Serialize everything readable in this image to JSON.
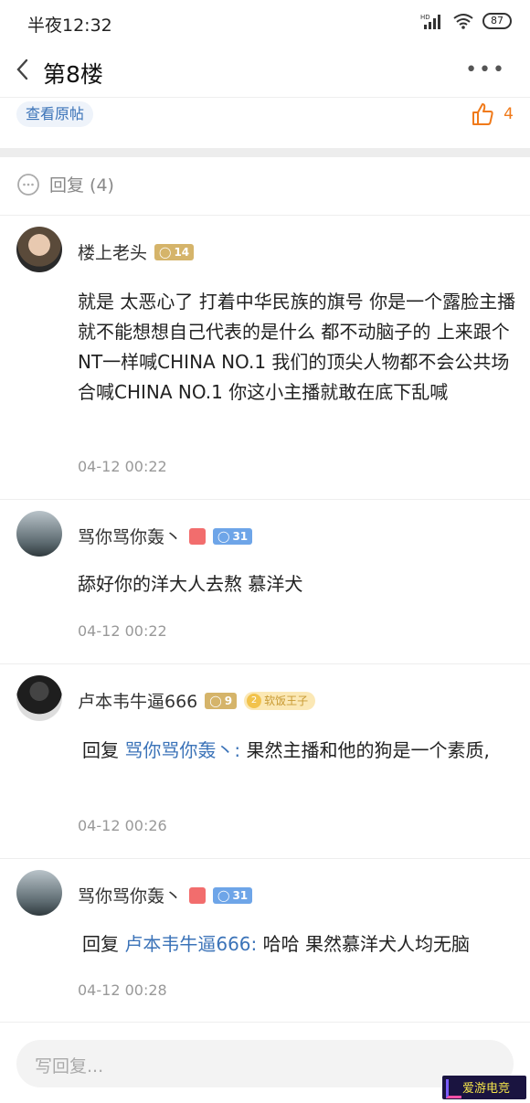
{
  "status": {
    "time": "半夜12:32",
    "hd": "HD",
    "battery": "87"
  },
  "nav": {
    "title": "第8楼"
  },
  "post": {
    "view_original": "查看原帖",
    "like_count": "4"
  },
  "replies_header": {
    "title": "回复 (4)"
  },
  "comments": [
    {
      "username": "楼上老头",
      "badges": [
        {
          "type": "level",
          "color": "#d5b46a",
          "value": "14"
        }
      ],
      "text": "就是 太恶心了 打着中华民族的旗号 你是一个露脸主播 就不能想想自己代表的是什么 都不动脑子的 上来跟个NT一样喊CHINA NO.1 我们的顶尖人物都不会公共场合喊CHINA NO.1 你这小主播就敢在底下乱喊",
      "time": "04-12 00:22"
    },
    {
      "username": "骂你骂你轰丶",
      "badges": [
        {
          "type": "icon",
          "color": "#f26d6d"
        },
        {
          "type": "level",
          "color": "#6ea5e8",
          "value": "31"
        }
      ],
      "text": "舔好你的洋大人去熬 慕洋犬",
      "time": "04-12 00:22"
    },
    {
      "username": "卢本韦牛逼666",
      "badges": [
        {
          "type": "level",
          "color": "#d5b46a",
          "value": "9"
        },
        {
          "type": "title",
          "num": "2",
          "label": "软饭王子"
        }
      ],
      "reply_prefix": "回复",
      "reply_to": "骂你骂你轰丶:",
      "text": "果然主播和他的狗是一个素质,",
      "time": "04-12 00:26"
    },
    {
      "username": "骂你骂你轰丶",
      "badges": [
        {
          "type": "icon",
          "color": "#f26d6d"
        },
        {
          "type": "level",
          "color": "#6ea5e8",
          "value": "31"
        }
      ],
      "reply_prefix": "回复",
      "reply_to": "卢本韦牛逼666:",
      "text": "哈哈 果然慕洋犬人均无脑",
      "time": "04-12 00:28"
    }
  ],
  "input": {
    "placeholder": "写回复..."
  },
  "watermark": {
    "text": "爱游电竞"
  }
}
